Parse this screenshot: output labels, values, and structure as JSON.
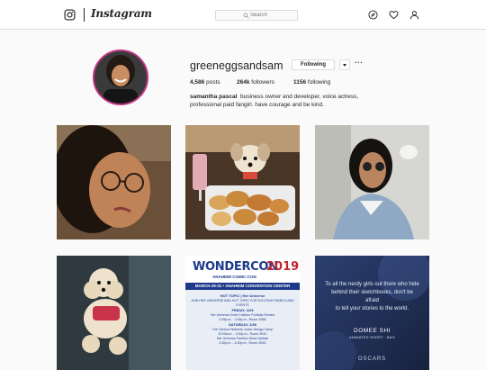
{
  "header": {
    "wordmark": "Instagram",
    "search_placeholder": "Search",
    "nav_icons": [
      "compass-icon",
      "heart-icon",
      "user-icon"
    ]
  },
  "profile": {
    "username": "greeneggsandsam",
    "follow_label": "Following",
    "more_label": "···",
    "stats": {
      "posts_count": "4,586",
      "posts_label": "posts",
      "followers_count": "264k",
      "followers_label": "followers",
      "following_count": "1156",
      "following_label": "following"
    },
    "name": "samantha pascal",
    "bio_line1": "business owner and developer, voice actress,",
    "bio_line2": "professional paid fangirl. have courage and be kind."
  },
  "posts": {
    "poster": {
      "title": "WONDERCON",
      "year": "2019",
      "subtitle": "ANAHEIM COMIC-CON",
      "dates": "MARCH 29-31 • ANAHEIM CONVENTION CENTER",
      "hottopic": "HOT TOPIC  |  Her Universe",
      "intro": "JOIN HER UNIVERSE AND HOT TOPIC FOR EXCITING PANELS AND EVENTS",
      "friday": "FRIDAY, 3/29",
      "friday_event": "Her Universe Geek Fashion Portfolio Review",
      "friday_time": "2:45p.m. - 3:45p.m., Room 206B",
      "saturday": "SATURDAY, 3/30",
      "sat_event1": "The Cartoon Network Junior Design Camp",
      "sat_time1": "10:00a.m. - 1:00p.m., Room 304C",
      "sat_event2": "Her Universe Fashion Show Update",
      "sat_time2": "3:30p.m. - 4:30p.m., Room 300D"
    },
    "quote": {
      "line1": "To all the nerdy girls out there who hide",
      "line2": "behind their sketchbooks, don't be afraid",
      "line3": "to tell your stories to the world.",
      "name": "DOMEE SHI",
      "sub": "ANIMATED SHORT · BAO",
      "brand": "OSCARS"
    }
  },
  "colors": {
    "story_ring": "#c13584",
    "border": "#dbdbdb",
    "text": "#262626",
    "background": "#fafafa"
  }
}
